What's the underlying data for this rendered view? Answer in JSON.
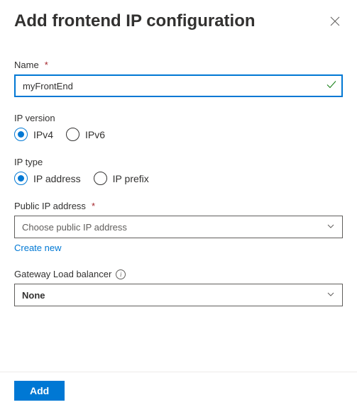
{
  "header": {
    "title": "Add frontend IP configuration"
  },
  "fields": {
    "name": {
      "label": "Name",
      "required_marker": "*",
      "value": "myFrontEnd"
    },
    "ip_version": {
      "label": "IP version",
      "options": {
        "ipv4": "IPv4",
        "ipv6": "IPv6"
      },
      "selected": "ipv4"
    },
    "ip_type": {
      "label": "IP type",
      "options": {
        "address": "IP address",
        "prefix": "IP prefix"
      },
      "selected": "address"
    },
    "public_ip": {
      "label": "Public IP address",
      "required_marker": "*",
      "placeholder": "Choose public IP address",
      "create_new": "Create new"
    },
    "gateway_lb": {
      "label": "Gateway Load balancer",
      "value": "None"
    }
  },
  "footer": {
    "add": "Add"
  }
}
